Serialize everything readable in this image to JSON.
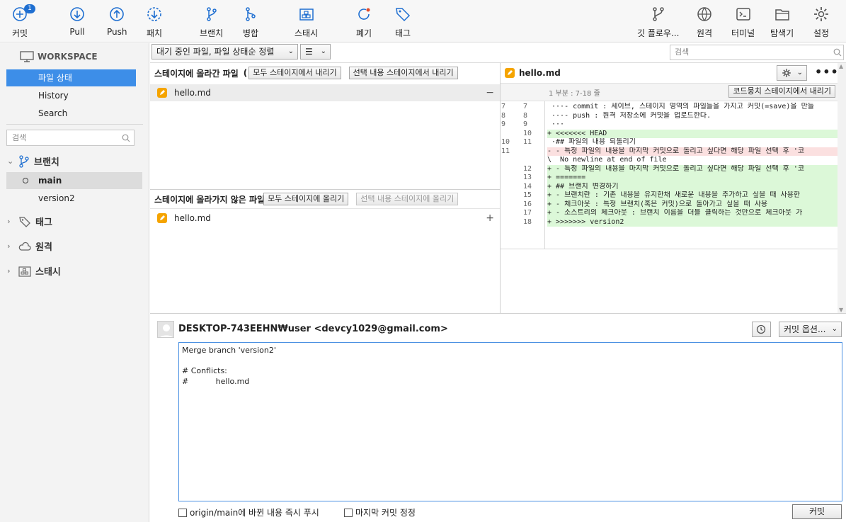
{
  "toolbar": {
    "commit": "커밋",
    "commit_badge": "1",
    "pull": "Pull",
    "push": "Push",
    "fetch": "패치",
    "branch": "브랜치",
    "merge": "병합",
    "stash": "스태시",
    "discard": "폐기",
    "tag": "태그",
    "gitflow": "깃 플로우...",
    "remote": "원격",
    "terminal": "터미널",
    "explorer": "탐색기",
    "settings": "설정"
  },
  "sidebar": {
    "workspace": "WORKSPACE",
    "items": [
      {
        "label": "파일 상태"
      },
      {
        "label": "History"
      },
      {
        "label": "Search"
      }
    ],
    "search_placeholder": "검색",
    "branches_label": "브랜치",
    "branches": [
      {
        "name": "main",
        "current": true
      },
      {
        "name": "version2",
        "current": false
      }
    ],
    "tags_label": "태그",
    "remotes_label": "원격",
    "stash_label": "스태시"
  },
  "filter": {
    "sort": "대기 중인 파일, 파일 상태순 정렬",
    "view": "☰",
    "search_placeholder": "검색"
  },
  "staged": {
    "title": "스테이지에 올라간 파일",
    "title_suffix": "(",
    "unstage_all": "모두 스테이지에서 내리기",
    "unstage_selected": "선택 내용 스테이지에서 내리기",
    "files": [
      {
        "name": "hello.md",
        "action": "−"
      }
    ]
  },
  "unstaged": {
    "title": "스테이지에 올라가지 않은 파일",
    "stage_all": "모두 스테이지에 올리기",
    "stage_selected": "선택 내용 스테이지에 올리기",
    "files": [
      {
        "name": "hello.md",
        "action": "+"
      }
    ]
  },
  "diff": {
    "file": "hello.md",
    "hunk_label": "1 부분 : 7-18 줄",
    "hunk_button": "코드뭉치 스테이지에서 내리기",
    "lines": [
      {
        "o": "7",
        "n": "7",
        "t": " ···- commit : 세이브, 스테이지 영역의 파일들을 가지고 커밋(=save)을 만들",
        "type": "ctx"
      },
      {
        "o": "8",
        "n": "8",
        "t": " ···- push : 원격 저장소에 커밋을 업로드한다.",
        "type": "ctx"
      },
      {
        "o": "9",
        "n": "9",
        "t": " ···",
        "type": "ctx"
      },
      {
        "o": "",
        "n": "10",
        "t": "+ <<<<<<< HEAD",
        "type": "add"
      },
      {
        "o": "10",
        "n": "11",
        "t": " ·## 파일의 내용 되돌리기",
        "type": "ctx"
      },
      {
        "o": "11",
        "n": "",
        "t": "- - 특정 파일의 내용을 마지막 커밋으로 돌리고 싶다면 해당 파일 선택 후 '코",
        "type": "del"
      },
      {
        "o": "",
        "n": "",
        "t": "\\  No newline at end of file",
        "type": "ctx"
      },
      {
        "o": "",
        "n": "12",
        "t": "+ - 특정 파일의 내용을 마지막 커밋으로 돌리고 싶다면 해당 파일 선택 후 '코",
        "type": "add"
      },
      {
        "o": "",
        "n": "13",
        "t": "+ =======",
        "type": "add"
      },
      {
        "o": "",
        "n": "14",
        "t": "+ ## 브랜치 변경하기",
        "type": "add"
      },
      {
        "o": "",
        "n": "15",
        "t": "+ - 브랜치란 : 기존 내용을 유지한채 새로운 내용을 추가하고 싶을 때 사용한",
        "type": "add"
      },
      {
        "o": "",
        "n": "16",
        "t": "+ - 체크아웃 : 특정 브랜치(혹은 커밋)으로 돌아가고 싶을 때 사용",
        "type": "add"
      },
      {
        "o": "",
        "n": "17",
        "t": "+ - 소스트리의 체크아웃 : 브랜치 이름을 더블 클릭하는 것만으로 체크아웃 가",
        "type": "add"
      },
      {
        "o": "",
        "n": "18",
        "t": "+ >>>>>>> version2",
        "type": "add"
      }
    ]
  },
  "commit": {
    "author": "DESKTOP-743EEHN₩user <devcy1029@gmail.com>",
    "options": "커밋 옵션...",
    "message_lines": [
      "Merge branch 'version2'",
      "",
      "# Conflicts:",
      "#           hello.md"
    ],
    "push_immediately": "origin/main에 바뀐 내용 즉시 푸시",
    "amend": "마지막 커밋 정정",
    "commit_button": "커밋"
  },
  "colors": {
    "accent": "#3d8ee8",
    "add_bg": "#dcf8d8",
    "del_bg": "#fbe0e0",
    "file_badge": "#f5a400"
  }
}
